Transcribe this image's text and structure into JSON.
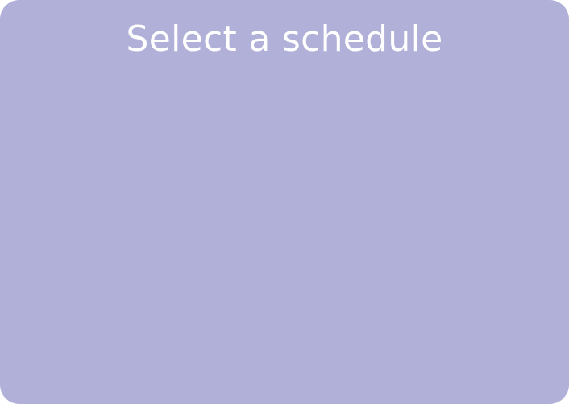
{
  "panel": {
    "title": "Select a schedule",
    "background_color": "#b0b0d8",
    "title_color": "#ffffff"
  }
}
